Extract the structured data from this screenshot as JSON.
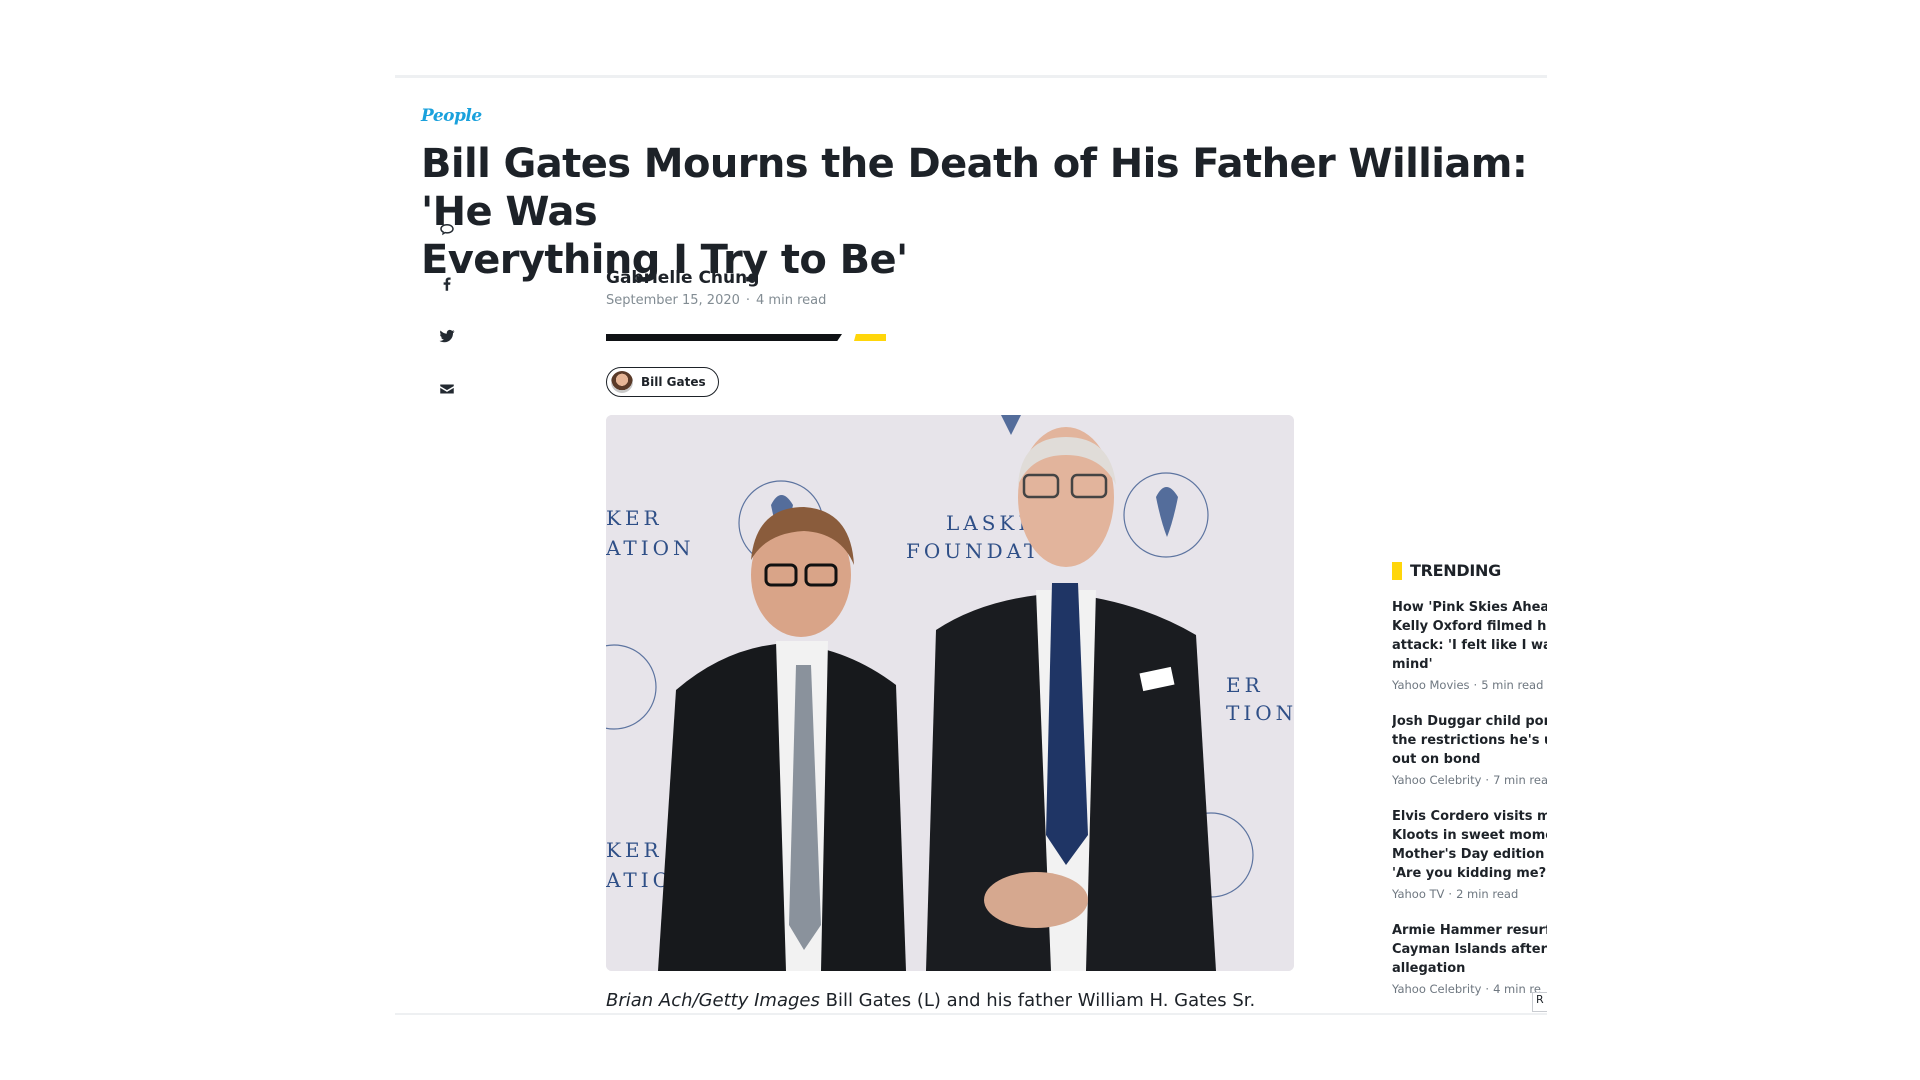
{
  "brand": {
    "name": "People",
    "color": "#1aa1dc"
  },
  "article": {
    "headline_line1": "Bill Gates Mourns the Death of His Father William: 'He Was",
    "headline_line2": "Everything I Try to Be'",
    "author": "Gabrielle Chung",
    "date": "September 15, 2020",
    "read_time": "4 min read",
    "tag": "Bill Gates",
    "image_credit": "Brian Ach/Getty Images",
    "caption": "Bill Gates (L) and his father William H. Gates Sr.",
    "accent_color": "#ffd60a"
  },
  "share": {
    "icons": [
      "comment-icon",
      "facebook-icon",
      "twitter-icon",
      "email-icon"
    ]
  },
  "trending": {
    "title": "TRENDING",
    "items": [
      {
        "lines": [
          "How 'Pink Skies Ahead'",
          "Kelly Oxford filmed her",
          "attack: 'I felt like I was l",
          "mind'"
        ],
        "source": "Yahoo Movies",
        "time": "5 min read"
      },
      {
        "lines": [
          "Josh Duggar child porn",
          "the restrictions he's unc",
          "out on bond"
        ],
        "source": "Yahoo Celebrity",
        "time": "7 min read"
      },
      {
        "lines": [
          "Elvis Cordero visits mor",
          "Kloots in sweet moment",
          "Mother's Day edition of",
          "'Are you kidding me?!'"
        ],
        "source": "Yahoo TV",
        "time": "2 min read"
      },
      {
        "lines": [
          "Armie Hammer resurfa",
          "Cayman Islands after M",
          "allegation"
        ],
        "source": "Yahoo Celebrity",
        "time": "4 min re"
      }
    ]
  },
  "photo_backdrop_text": {
    "left_top": [
      "KER",
      "ATION"
    ],
    "center": [
      "LASKE",
      "FOUNDAT"
    ],
    "right": [
      "ER",
      "TION"
    ],
    "left_bottom": [
      "KER",
      "ATIO"
    ]
  },
  "corner_badge": "R"
}
